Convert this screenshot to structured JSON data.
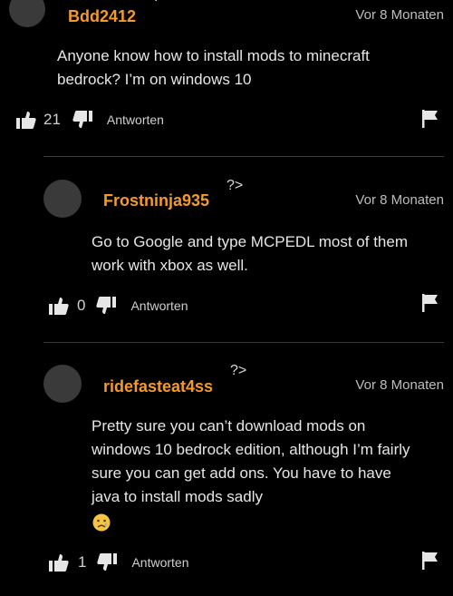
{
  "comments": [
    {
      "username": "Bdd2412",
      "marker": "?>",
      "time": "Vor 8 Monaten",
      "text_lines": [
        "Anyone know how to install mods to minecraft",
        "bedrock? I’m on windows 10"
      ],
      "likes": "21",
      "reply_label": "Antworten"
    },
    {
      "username": "Frostninja935",
      "marker": "?>",
      "time": "Vor 8 Monaten",
      "text_lines": [
        "Go to Google and type MCPEDL most of them",
        "work with xbox as well."
      ],
      "likes": "0",
      "reply_label": "Antworten"
    },
    {
      "username": "ridefasteat4ss",
      "marker": "?>",
      "time": "Vor 8 Monaten",
      "text_lines": [
        "Pretty sure you can’t download mods on",
        "windows 10 bedrock edition, although I’m fairly",
        "sure you can get add ons. You have to have",
        "java to install mods sadly"
      ],
      "likes": "1",
      "reply_label": "Antworten"
    }
  ],
  "colors": {
    "background": "#000000",
    "username": "#f39a2b",
    "text": "#e6e6e6",
    "divider": "#3a3a3a"
  },
  "icons": [
    "thumbs-up-icon",
    "thumbs-down-icon",
    "flag-icon",
    "sad-face-emoji"
  ]
}
